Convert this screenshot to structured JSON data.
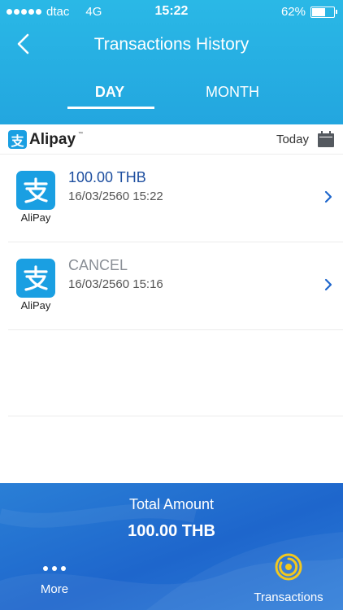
{
  "status_bar": {
    "carrier": "dtac",
    "network": "4G",
    "time": "15:22",
    "battery": "62%",
    "battery_level": 0.62
  },
  "header": {
    "title": "Transactions History"
  },
  "tabs": [
    {
      "label": "DAY",
      "active": true
    },
    {
      "label": "MONTH",
      "active": false
    }
  ],
  "provider": {
    "name": "Alipay",
    "logo_glyph": "支",
    "date_filter": "Today"
  },
  "transactions": [
    {
      "app_label": "AliPay",
      "amount": "100.00 THB",
      "datetime": "16/03/2560 15:22"
    },
    {
      "app_label": "AliPay",
      "amount": "CANCEL",
      "datetime": "16/03/2560 15:16"
    }
  ],
  "footer": {
    "total_label": "Total Amount",
    "total_value": "100.00 THB",
    "more_label": "More",
    "transactions_label": "Transactions"
  },
  "colors": {
    "header_blue": "#23a6df",
    "amount_blue": "#1e4fa0",
    "alipay_blue": "#1a9fe2",
    "footer_blue": "#1e66cc",
    "accent_yellow": "#f2c81e"
  }
}
